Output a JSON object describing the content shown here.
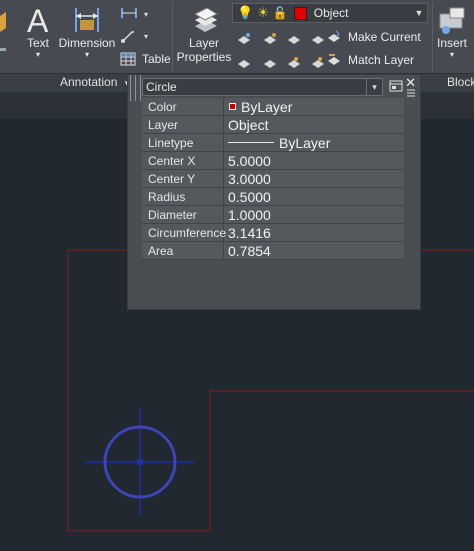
{
  "ribbon": {
    "text_label": "Text",
    "dimension_label": "Dimension",
    "table_label": "Table",
    "layer_properties_label": "Layer\nProperties",
    "make_current_label": "Make Current",
    "match_layer_label": "Match Layer",
    "insert_label": "Insert",
    "annotation_group": "Annotation",
    "block_group": "Block",
    "current_layer": "Object",
    "current_layer_color": "#e00000"
  },
  "palette": {
    "selected_object": "Circle",
    "properties": [
      {
        "name": "Color",
        "value": "ByLayer",
        "swatch": "#c00000"
      },
      {
        "name": "Layer",
        "value": "Object"
      },
      {
        "name": "Linetype",
        "value": "ByLayer"
      },
      {
        "name": "Center X",
        "value": "5.0000"
      },
      {
        "name": "Center Y",
        "value": "3.0000"
      },
      {
        "name": "Radius",
        "value": "0.5000"
      },
      {
        "name": "Diameter",
        "value": "1.0000"
      },
      {
        "name": "Circumference",
        "value": "3.1416"
      },
      {
        "name": "Area",
        "value": "0.7854"
      }
    ]
  },
  "colors": {
    "drawing_bg": "#212830",
    "object_line": "#8b1a1a",
    "circle_stroke": "#3d44b8",
    "crosshair": "#1f2fa8"
  }
}
